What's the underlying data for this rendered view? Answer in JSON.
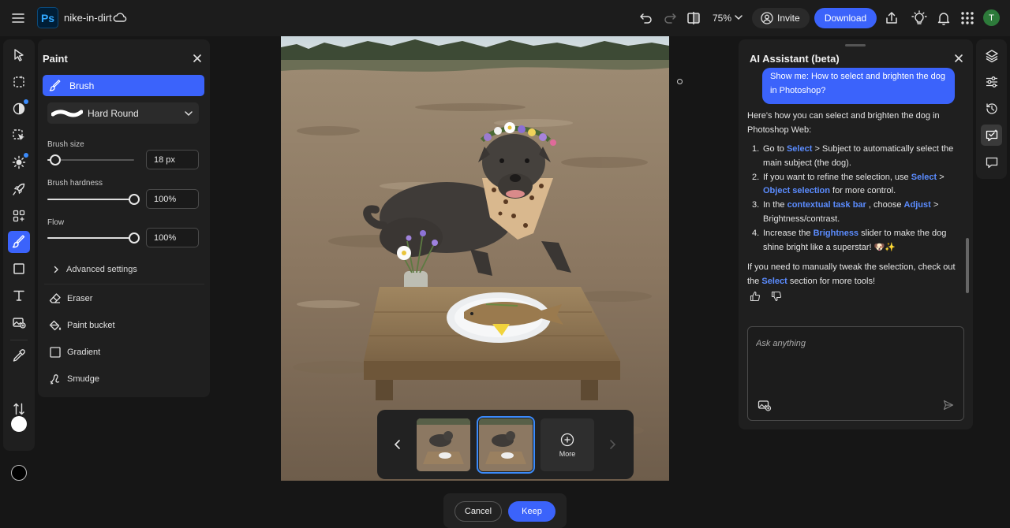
{
  "header": {
    "app_logo_text": "Ps",
    "document_name": "nike-in-dirt",
    "zoom_level": "75%",
    "invite_label": "Invite",
    "download_label": "Download",
    "avatar_initial": "T"
  },
  "paint_panel": {
    "title": "Paint",
    "active_tool_label": "Brush",
    "brush_preset": "Hard Round",
    "brush_size": {
      "label": "Brush size",
      "value": "18 px",
      "percent": 9
    },
    "brush_hardness": {
      "label": "Brush hardness",
      "value": "100%",
      "percent": 100
    },
    "flow": {
      "label": "Flow",
      "value": "100%",
      "percent": 100
    },
    "advanced_label": "Advanced settings",
    "other_tools": [
      {
        "label": "Eraser",
        "icon": "eraser-icon"
      },
      {
        "label": "Paint bucket",
        "icon": "paint-bucket-icon"
      },
      {
        "label": "Gradient",
        "icon": "gradient-icon"
      },
      {
        "label": "Smudge",
        "icon": "smudge-icon"
      }
    ]
  },
  "canvas": {
    "variations_more_label": "More",
    "cancel_label": "Cancel",
    "keep_label": "Keep"
  },
  "ai_panel": {
    "title": "AI Assistant (beta)",
    "user_message": "Show me: How to select and brighten the dog in Photoshop?",
    "reply_intro": "Here's how you can select and brighten the dog in Photoshop Web:",
    "steps": [
      {
        "n": "1.",
        "t1": "Go to ",
        "k1": "Select",
        "t2": " > Subject to automatically select the main subject (the dog).",
        "k2": "",
        "t3": ""
      },
      {
        "n": "2.",
        "t1": "If you want to refine the selection, use ",
        "k1": "Select",
        "t2": " > ",
        "k2": "Object selection",
        "t3": " for more control."
      },
      {
        "n": "3.",
        "t1": "In the ",
        "k1": "contextual task bar",
        "t2": " , choose ",
        "k2": "Adjust",
        "t3": " > Brightness/contrast."
      },
      {
        "n": "4.",
        "t1": "Increase the ",
        "k1": "Brightness",
        "t2": " slider to make the dog shine bright like a superstar! 🐶✨",
        "k2": "",
        "t3": ""
      }
    ],
    "reply_outro_start": "If you need to manually tweak the selection, check out the ",
    "reply_outro_keyword": "Select",
    "reply_outro_end": " section for more tools!",
    "input_placeholder": "Ask anything"
  },
  "colors": {
    "accent": "#3b63fb",
    "keyword": "#5b8cff",
    "panel_bg": "#1f1f1f",
    "app_bg": "#161616"
  }
}
